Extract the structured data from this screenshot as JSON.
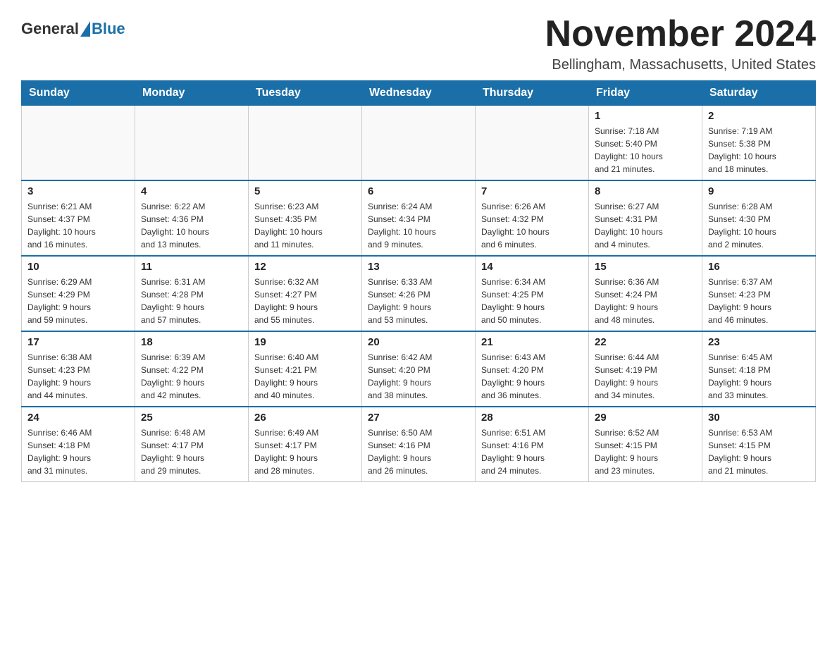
{
  "header": {
    "logo": {
      "general": "General",
      "blue": "Blue"
    },
    "title": "November 2024",
    "subtitle": "Bellingham, Massachusetts, United States"
  },
  "weekdays": [
    "Sunday",
    "Monday",
    "Tuesday",
    "Wednesday",
    "Thursday",
    "Friday",
    "Saturday"
  ],
  "weeks": [
    [
      {
        "day": "",
        "info": ""
      },
      {
        "day": "",
        "info": ""
      },
      {
        "day": "",
        "info": ""
      },
      {
        "day": "",
        "info": ""
      },
      {
        "day": "",
        "info": ""
      },
      {
        "day": "1",
        "info": "Sunrise: 7:18 AM\nSunset: 5:40 PM\nDaylight: 10 hours\nand 21 minutes."
      },
      {
        "day": "2",
        "info": "Sunrise: 7:19 AM\nSunset: 5:38 PM\nDaylight: 10 hours\nand 18 minutes."
      }
    ],
    [
      {
        "day": "3",
        "info": "Sunrise: 6:21 AM\nSunset: 4:37 PM\nDaylight: 10 hours\nand 16 minutes."
      },
      {
        "day": "4",
        "info": "Sunrise: 6:22 AM\nSunset: 4:36 PM\nDaylight: 10 hours\nand 13 minutes."
      },
      {
        "day": "5",
        "info": "Sunrise: 6:23 AM\nSunset: 4:35 PM\nDaylight: 10 hours\nand 11 minutes."
      },
      {
        "day": "6",
        "info": "Sunrise: 6:24 AM\nSunset: 4:34 PM\nDaylight: 10 hours\nand 9 minutes."
      },
      {
        "day": "7",
        "info": "Sunrise: 6:26 AM\nSunset: 4:32 PM\nDaylight: 10 hours\nand 6 minutes."
      },
      {
        "day": "8",
        "info": "Sunrise: 6:27 AM\nSunset: 4:31 PM\nDaylight: 10 hours\nand 4 minutes."
      },
      {
        "day": "9",
        "info": "Sunrise: 6:28 AM\nSunset: 4:30 PM\nDaylight: 10 hours\nand 2 minutes."
      }
    ],
    [
      {
        "day": "10",
        "info": "Sunrise: 6:29 AM\nSunset: 4:29 PM\nDaylight: 9 hours\nand 59 minutes."
      },
      {
        "day": "11",
        "info": "Sunrise: 6:31 AM\nSunset: 4:28 PM\nDaylight: 9 hours\nand 57 minutes."
      },
      {
        "day": "12",
        "info": "Sunrise: 6:32 AM\nSunset: 4:27 PM\nDaylight: 9 hours\nand 55 minutes."
      },
      {
        "day": "13",
        "info": "Sunrise: 6:33 AM\nSunset: 4:26 PM\nDaylight: 9 hours\nand 53 minutes."
      },
      {
        "day": "14",
        "info": "Sunrise: 6:34 AM\nSunset: 4:25 PM\nDaylight: 9 hours\nand 50 minutes."
      },
      {
        "day": "15",
        "info": "Sunrise: 6:36 AM\nSunset: 4:24 PM\nDaylight: 9 hours\nand 48 minutes."
      },
      {
        "day": "16",
        "info": "Sunrise: 6:37 AM\nSunset: 4:23 PM\nDaylight: 9 hours\nand 46 minutes."
      }
    ],
    [
      {
        "day": "17",
        "info": "Sunrise: 6:38 AM\nSunset: 4:23 PM\nDaylight: 9 hours\nand 44 minutes."
      },
      {
        "day": "18",
        "info": "Sunrise: 6:39 AM\nSunset: 4:22 PM\nDaylight: 9 hours\nand 42 minutes."
      },
      {
        "day": "19",
        "info": "Sunrise: 6:40 AM\nSunset: 4:21 PM\nDaylight: 9 hours\nand 40 minutes."
      },
      {
        "day": "20",
        "info": "Sunrise: 6:42 AM\nSunset: 4:20 PM\nDaylight: 9 hours\nand 38 minutes."
      },
      {
        "day": "21",
        "info": "Sunrise: 6:43 AM\nSunset: 4:20 PM\nDaylight: 9 hours\nand 36 minutes."
      },
      {
        "day": "22",
        "info": "Sunrise: 6:44 AM\nSunset: 4:19 PM\nDaylight: 9 hours\nand 34 minutes."
      },
      {
        "day": "23",
        "info": "Sunrise: 6:45 AM\nSunset: 4:18 PM\nDaylight: 9 hours\nand 33 minutes."
      }
    ],
    [
      {
        "day": "24",
        "info": "Sunrise: 6:46 AM\nSunset: 4:18 PM\nDaylight: 9 hours\nand 31 minutes."
      },
      {
        "day": "25",
        "info": "Sunrise: 6:48 AM\nSunset: 4:17 PM\nDaylight: 9 hours\nand 29 minutes."
      },
      {
        "day": "26",
        "info": "Sunrise: 6:49 AM\nSunset: 4:17 PM\nDaylight: 9 hours\nand 28 minutes."
      },
      {
        "day": "27",
        "info": "Sunrise: 6:50 AM\nSunset: 4:16 PM\nDaylight: 9 hours\nand 26 minutes."
      },
      {
        "day": "28",
        "info": "Sunrise: 6:51 AM\nSunset: 4:16 PM\nDaylight: 9 hours\nand 24 minutes."
      },
      {
        "day": "29",
        "info": "Sunrise: 6:52 AM\nSunset: 4:15 PM\nDaylight: 9 hours\nand 23 minutes."
      },
      {
        "day": "30",
        "info": "Sunrise: 6:53 AM\nSunset: 4:15 PM\nDaylight: 9 hours\nand 21 minutes."
      }
    ]
  ]
}
